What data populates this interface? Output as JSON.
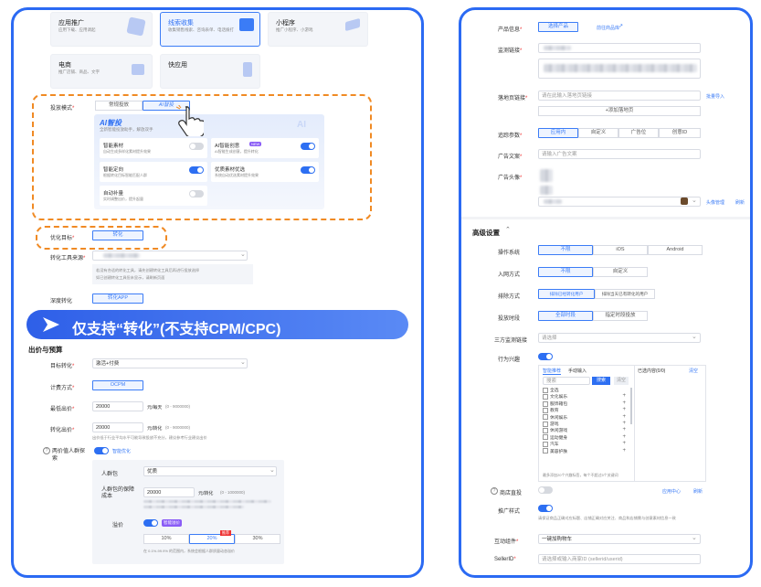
{
  "left": {
    "cards": [
      {
        "title": "应用推广",
        "desc": "应用下载、应用调起"
      },
      {
        "title": "线索收集",
        "desc": "收集销售线索、咨询表单、电话拨打"
      },
      {
        "title": "小程序",
        "desc": "推广小程序、小游戏"
      },
      {
        "title": "电商",
        "desc": "推广店铺、商品、文字"
      },
      {
        "title": "快应用",
        "desc": ""
      }
    ],
    "mode": {
      "label": "投放模式",
      "options": [
        "常规投放",
        "AI智投"
      ]
    },
    "ai": {
      "title": "AI智投",
      "subtitle": "全新智能投放助手，解放双手",
      "badge": "AI",
      "items": [
        {
          "title": "智能素材",
          "desc": "自动生成多样化素材提升效果",
          "on": false
        },
        {
          "title": "AI智能创意",
          "desc": "AI智能生成创意，提升转化",
          "badge": "NEW",
          "on": true
        },
        {
          "title": "智能定向",
          "desc": "根据转化目标智能匹配人群",
          "on": true
        },
        {
          "title": "优质素材优选",
          "desc": "系统自动优选素材提升效果",
          "on": true
        },
        {
          "title": "自动补量",
          "desc": "实时调整出价，提升起量",
          "on": false
        }
      ]
    },
    "cursor": "pointer-hand",
    "opt_goal": {
      "label": "优化目标",
      "value": "转化"
    },
    "conv_source": {
      "label": "转化工具来源",
      "helper": "若没有合适的转化工具，请先创建转化工具后再进行投放选择",
      "helper2": "如已创建转化工具但未显示，请刷新页面"
    },
    "deep_conv": {
      "label": "深度转化",
      "value": "转化APP"
    },
    "banner": {
      "text": "仅支持“转化”(不支持CPM/CPC)"
    },
    "bid": {
      "section": "出价与预算",
      "target_label": "目标转化",
      "target_value": "激活+付费",
      "method_label": "计费方式",
      "method_value": "OCPM",
      "budget_label": "最低出价",
      "budget_value": "20000",
      "budget_unit": "元/每天",
      "budget_range": "(0 - 9000000)",
      "bid_label": "转化出价",
      "bid_value": "20000",
      "bid_unit": "元/转化",
      "bid_range": "(0 - 9000000)",
      "bid_note": "出价低于行业平均水平可能导致投放不充分，建议参考行业建议出价"
    },
    "advanced": {
      "label": "两价值人群探索",
      "toggle_label": "智能优化",
      "pack_label": "人群包",
      "pack_value": "优质",
      "cost_label": "人群包的保障成本",
      "cost_value": "20000",
      "cost_unit": "元/转化",
      "cost_range": "(0 - 1000000)",
      "ratio_label": "溢价",
      "ratio_badge": "智能溢价",
      "ratio_options": [
        "10%",
        "20%",
        "30%"
      ],
      "ratio_tag": "推荐",
      "ratio_note": "在 0.1%-99.9% 的范围内，系统会根据人群质量动态溢价"
    }
  },
  "right": {
    "product": {
      "label": "产品信息",
      "button": "选择产品",
      "link": "前往商品库"
    },
    "monitor": {
      "label": "监测链接"
    },
    "landing": {
      "label": "落地页链接",
      "placeholder": "请在此输入落地页链接",
      "add": "+添加落地页",
      "link": "批量导入"
    },
    "tracking": {
      "label": "追踪参数",
      "options": [
        "应用内",
        "自定义",
        "广告位",
        "创意ID"
      ]
    },
    "ad_text": {
      "label": "广告文案",
      "placeholder": "请输入广告文案"
    },
    "avatar": {
      "label": "广告头像",
      "link1": "头像管理",
      "link2": "刷新"
    },
    "advanced": {
      "section": "高级设置",
      "os": {
        "label": "操作系统",
        "options": [
          "不限",
          "iOS",
          "Android"
        ]
      },
      "entry": {
        "label": "入网方式",
        "options": [
          "不限",
          "自定义"
        ]
      },
      "exclude": {
        "label": "排除方式",
        "options": [
          "排除已经转化用户",
          "排除当天已有转化的用户"
        ]
      },
      "time": {
        "label": "投放时段",
        "options": [
          "全部时段",
          "指定时段投放"
        ]
      },
      "third": {
        "label": "三方监测链接",
        "placeholder": "请选择"
      },
      "behavior": {
        "label": "行为兴趣",
        "tabs": [
          "智能推荐",
          "手动输入"
        ],
        "search_placeholder": "搜索",
        "search_button": "搜索",
        "clear_button": "清空",
        "right_title": "已选内容(0/0)",
        "right_link": "清空",
        "items": [
          "全选",
          "文化娱乐",
          "服饰箱包",
          "教育",
          "休闲娱乐",
          "游戏",
          "休闲游戏",
          "运动健身",
          "汽车",
          "美容护肤"
        ],
        "footer": "最多添加20个兴趣标签，每个不超过5个关键词"
      },
      "store": {
        "label": "商店直投",
        "link1": "应用中心",
        "link2": "刷新"
      },
      "promo": {
        "label": "推广样式",
        "note": "请保证商品正确对应标题、店铺正确对应关注、商品和店铺需与创意素材信息一致"
      },
      "component": {
        "label": "互动组件",
        "value": "一键加购物车"
      },
      "seller": {
        "label": "SellerID",
        "placeholder": "请选择或输入商家ID (sellerid/userid)"
      }
    }
  },
  "colors": {
    "primary": "#2d6ff2",
    "accent_orange": "#f08a24",
    "panel_border": "#2b6af3"
  }
}
